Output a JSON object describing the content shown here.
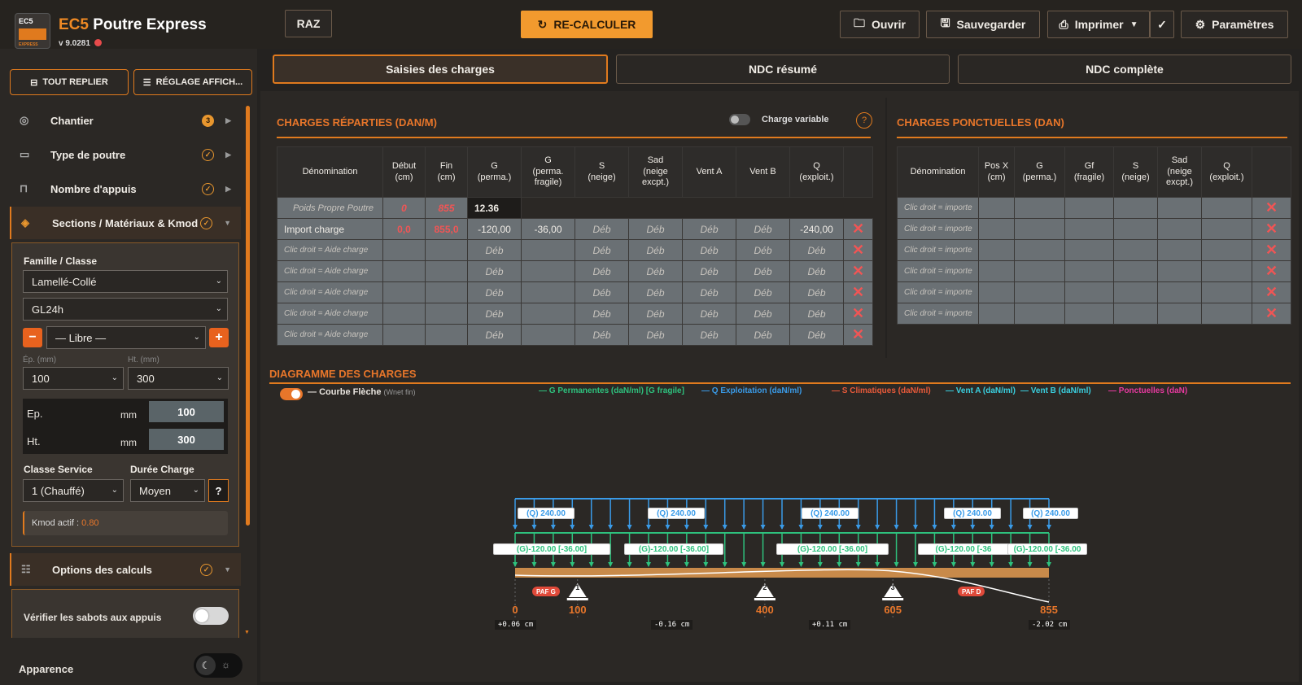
{
  "app": {
    "logo_text": "EC5",
    "logo_sub": "EXPRESS",
    "title_prefix": "EC5",
    "title": " Poutre Express",
    "version": "v 9.0281"
  },
  "toolbar": {
    "raz": "RAZ",
    "recalc": "RE-CALCULER",
    "open": "Ouvrir",
    "save": "Sauvegarder",
    "print": "Imprimer",
    "settings": "Paramètres"
  },
  "sidebar": {
    "collapse_all": "TOUT REPLIER",
    "display_settings": "RÉGLAGE AFFICH...",
    "items": [
      {
        "label": "Chantier",
        "badge": "3"
      },
      {
        "label": "Type de poutre"
      },
      {
        "label": "Nombre d'appuis"
      },
      {
        "label": "Sections / Matériaux & Kmod"
      },
      {
        "label": "Options des calculs"
      }
    ],
    "section": {
      "family_label": "Famille / Classe",
      "family": "Lamellé-Collé",
      "grade": "GL24h",
      "preset": "— Libre —",
      "ep_small": "Ép. (mm)",
      "ht_small": "Ht. (mm)",
      "ep_sel": "100",
      "ht_sel": "300",
      "ep_label": "Ep.",
      "ht_label": "Ht.",
      "unit": "mm",
      "ep_val": "100",
      "ht_val": "300",
      "service_label": "Classe Service",
      "duration_label": "Durée Charge",
      "service": "1 (Chauffé)",
      "duration": "Moyen",
      "help": "?",
      "kmod_label": "Kmod actif :",
      "kmod_val": "0.80"
    },
    "options": {
      "check_label": "Vérifier les sabots aux appuis"
    },
    "appearance": "Apparence"
  },
  "tabs": [
    "Saisies des charges",
    "NDC résumé",
    "NDC complète"
  ],
  "distributed": {
    "title": "CHARGES RÉPARTIES (DAN/M)",
    "variable_toggle": "Charge variable",
    "help": "?",
    "headers": [
      "Dénomination",
      "Début\n(cm)",
      "Fin\n(cm)",
      "G\n(perma.)",
      "G\n(perma.\nfragile)",
      "S\n(neige)",
      "Sad\n(neige\nexcpt.)",
      "Vent A",
      "Vent B",
      "Q\n(exploit.)"
    ],
    "self_weight": {
      "name": "Poids Propre Poutre",
      "start": "0",
      "end": "855",
      "g": "12.36"
    },
    "import": {
      "name": "Import charge",
      "start": "0,0",
      "end": "855,0",
      "g": "-120,00",
      "gf": "-36,00",
      "s": "Déb",
      "sad": "Déb",
      "va": "Déb",
      "vb": "Déb",
      "q": "-240,00"
    },
    "empty_row": {
      "name": "Clic droit = Aide charge",
      "deb": "Déb"
    },
    "empty_count": 5
  },
  "point": {
    "title": "CHARGES PONCTUELLES (DAN)",
    "headers": [
      "Dénomination",
      "Pos X\n(cm)",
      "G\n(perma.)",
      "Gf\n(fragile)",
      "S\n(neige)",
      "Sad\n(neige\nexcpt.)",
      "Q\n(exploit.)"
    ],
    "row_name": "Clic droit = importe",
    "rows": 6
  },
  "diagram": {
    "title": "DIAGRAMME DES CHARGES",
    "curve_label": "Courbe Flèche",
    "curve_sub": "(Wnet fin)",
    "legend": [
      {
        "label": "— G Permanentes (daN/ml) [G fragile]",
        "color": "#2ec27e"
      },
      {
        "label": "— Q Exploitation (daN/ml)",
        "color": "#3a9be8"
      },
      {
        "label": "— S Climatiques (daN/ml)",
        "color": "#e85a3a"
      },
      {
        "label": "— Vent A (daN/ml)",
        "color": "#3ad0e0"
      },
      {
        "label": "— Vent B (daN/ml)",
        "color": "#3ad0e0"
      },
      {
        "label": "— Ponctuelles (daN)",
        "color": "#e83aa0"
      }
    ],
    "q_labels": [
      "(Q) 240.00",
      "(Q) 240.00",
      "(Q) 240.00",
      "(Q) 240.00",
      "(Q) 240.00"
    ],
    "g_labels": [
      "(G)-120.00 [-36.00]",
      "(G)-120.00 [-36.00]",
      "(G)-120.00 [-36.00]",
      "(G)-120.00 [-36",
      "(G)-120.00 [-36.00"
    ],
    "positions": [
      "0",
      "100",
      "400",
      "605",
      "855"
    ],
    "support_nums": [
      "1",
      "2",
      "3"
    ],
    "paf_g": "PAF G",
    "paf_d": "PAF D",
    "deflections": [
      "+0.06 cm",
      "-0.16 cm",
      "+0.11 cm",
      "-2.02 cm"
    ],
    "colors": {
      "q": "#3a9be8",
      "g": "#2ec27e",
      "beam": "#c88a4a",
      "curve": "#ffffff"
    }
  }
}
